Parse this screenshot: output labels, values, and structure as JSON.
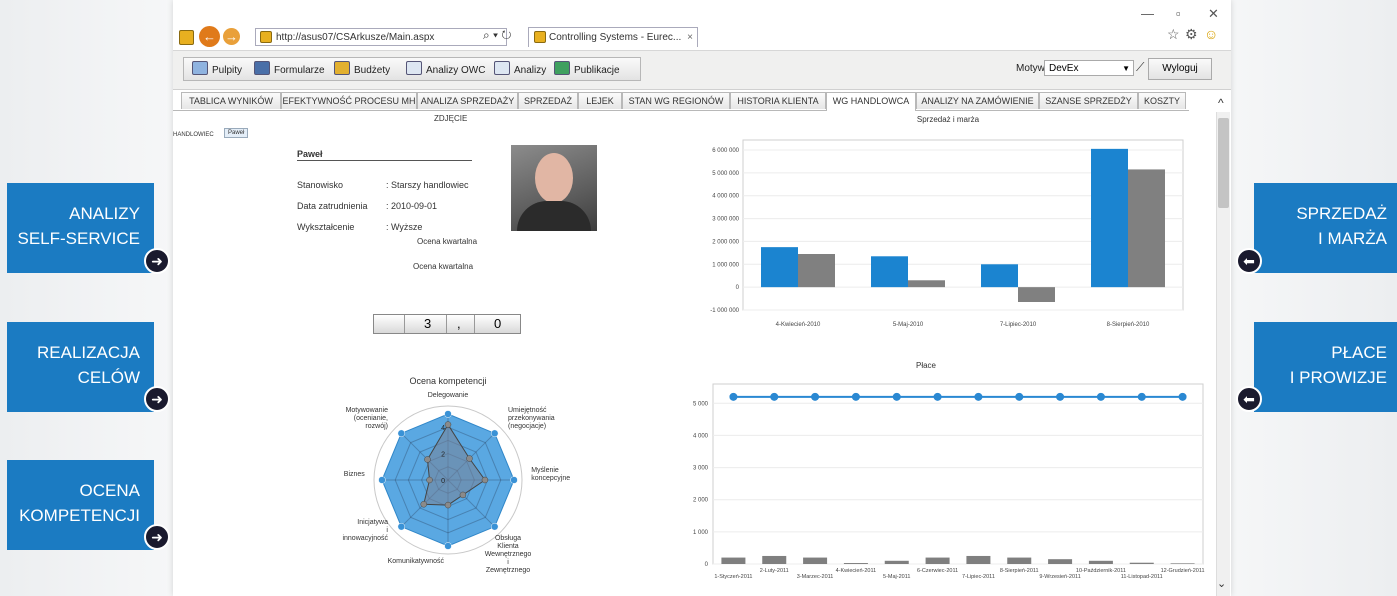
{
  "browser": {
    "url": "http://asus07/CSArkusze/Main.aspx",
    "tab_title": "Controlling Systems - Eurec...",
    "tab_close": "×",
    "search_refresh": "⌕ ▾ ↻"
  },
  "toolbar": {
    "items": [
      "Pulpity",
      "Formularze",
      "Budżety",
      "Analizy OWC",
      "Analizy",
      "Publikacje"
    ],
    "motywy_label": "Motywy:",
    "motywy_value": "DevEx",
    "logout_label": "Wyloguj"
  },
  "tabs": [
    "TABLICA WYNIKÓW",
    "EFEKTYWNOŚĆ PROCESU MH",
    "ANALIZA SPRZEDAŻY",
    "SPRZEDAŻ",
    "LEJEK",
    "STAN WG REGIONÓW",
    "HISTORIA KLIENTA",
    "WG HANDLOWCA",
    "ANALIZY NA ZAMÓWIENIE",
    "SZANSE SPRZEDŻY",
    "KOSZTY"
  ],
  "active_tab_index": 7,
  "filter": {
    "label": "HANDLOWIEC",
    "value": "Paweł"
  },
  "profile": {
    "photo_title": "ZDJĘCIE",
    "name": "Paweł",
    "fields": [
      {
        "label": "Stanowisko",
        "value": ": Starszy handlowiec"
      },
      {
        "label": "Data zatrudnienia",
        "value": ": 2010-09-01"
      },
      {
        "label": "Wykształcenie",
        "value": ": Wyższe"
      }
    ],
    "rating1": "Ocena kwartalna",
    "rating2": "Ocena kwartalna",
    "counter": {
      "whole": "3",
      "sep": ",",
      "frac": "0"
    }
  },
  "chart_data": [
    {
      "type": "radar",
      "title": "Ocena kompetencji",
      "axes": [
        "Delegowanie",
        "Umiejętność przekonywania (negocjacje)",
        "Myślenie koncepcyjne",
        "Obsługa Klienta Wewnętrznego i Zewnętrznego",
        "Komunikatywność",
        "Inicjatywa i innowacyjność",
        "Biznes",
        "Motywowanie (ocenianie, rozwój)"
      ],
      "axis_labels": [
        [
          "Delegowanie"
        ],
        [
          "Umiejętność",
          "przekonywania",
          "(negocjacje)"
        ],
        [
          "Myślenie",
          "koncepcyjne"
        ],
        [
          "Obsługa",
          "Klienta",
          "Wewnętrznego",
          "i",
          "Zewnętrznego"
        ],
        [
          "Komunikatywność"
        ],
        [
          "Inicjatywa",
          "i",
          "innowacyjność"
        ],
        [
          "Biznes"
        ],
        [
          "Motywowanie",
          "(ocenianie,",
          "rozwój)"
        ]
      ],
      "ticks": [
        "0",
        "2",
        "4"
      ],
      "range": [
        0,
        5
      ],
      "series": [
        {
          "values": [
            5,
            5,
            5,
            5,
            5,
            5,
            5,
            5
          ]
        },
        {
          "values": [
            4.2,
            2.3,
            2.8,
            1.6,
            1.9,
            2.6,
            1.4,
            2.2
          ]
        }
      ]
    },
    {
      "type": "bar",
      "title": "Sprzedaż i marża",
      "categories": [
        "4-Kwiecień-2010",
        "5-Maj-2010",
        "7-Lipiec-2010",
        "8-Sierpień-2010"
      ],
      "series": [
        {
          "values": [
            1750000,
            1350000,
            1000000,
            6050000
          ],
          "color": "#1b84d0"
        },
        {
          "values": [
            1450000,
            300000,
            -650000,
            5150000
          ],
          "color": "#808080"
        }
      ],
      "ylim": [
        -1000000,
        6000000
      ],
      "yticks": [
        -1000000,
        0,
        1000000,
        2000000,
        3000000,
        4000000,
        5000000,
        6000000
      ],
      "ytick_labels": [
        "-1 000 000",
        "0",
        "1 000 000",
        "2 000 000",
        "3 000 000",
        "4 000 000",
        "5 000 000",
        "6 000 000"
      ]
    },
    {
      "type": "bar+line",
      "title": "Płace",
      "categories": [
        "1-Styczeń-2011",
        "2-Luty-2011",
        "3-Marzec-2011",
        "4-Kwiecień-2011",
        "5-Maj-2011",
        "6-Czerwiec-2011",
        "7-Lipiec-2011",
        "8-Sierpień-2011",
        "9-Wrzesień-2011",
        "10-Październik-2011",
        "11-Listopad-2011",
        "12-Grudzień-2011"
      ],
      "bar_values": [
        200,
        250,
        200,
        30,
        100,
        200,
        250,
        200,
        150,
        100,
        40,
        20
      ],
      "line_values": [
        5200,
        5200,
        5200,
        5200,
        5200,
        5200,
        5200,
        5200,
        5200,
        5200,
        5200,
        5200
      ],
      "ylim": [
        0,
        5600
      ],
      "yticks": [
        0,
        1000,
        2000,
        3000,
        4000,
        5000
      ],
      "ytick_labels": [
        "0",
        "1 000",
        "2 000",
        "3 000",
        "4 000",
        "5 000"
      ]
    }
  ],
  "callouts": {
    "left": [
      [
        "ANALIZY",
        "SELF-SERVICE"
      ],
      [
        "REALIZACJA",
        "CELÓW"
      ],
      [
        "OCENA",
        "KOMPETENCJI"
      ]
    ],
    "right": [
      [
        "SPRZEDAŻ",
        "I MARŻA"
      ],
      [
        "PŁACE",
        "I PROWIZJE"
      ]
    ]
  },
  "colors": {
    "accent": "#1b7bc2",
    "bar_blue": "#1b84d0",
    "bar_gray": "#808080"
  }
}
